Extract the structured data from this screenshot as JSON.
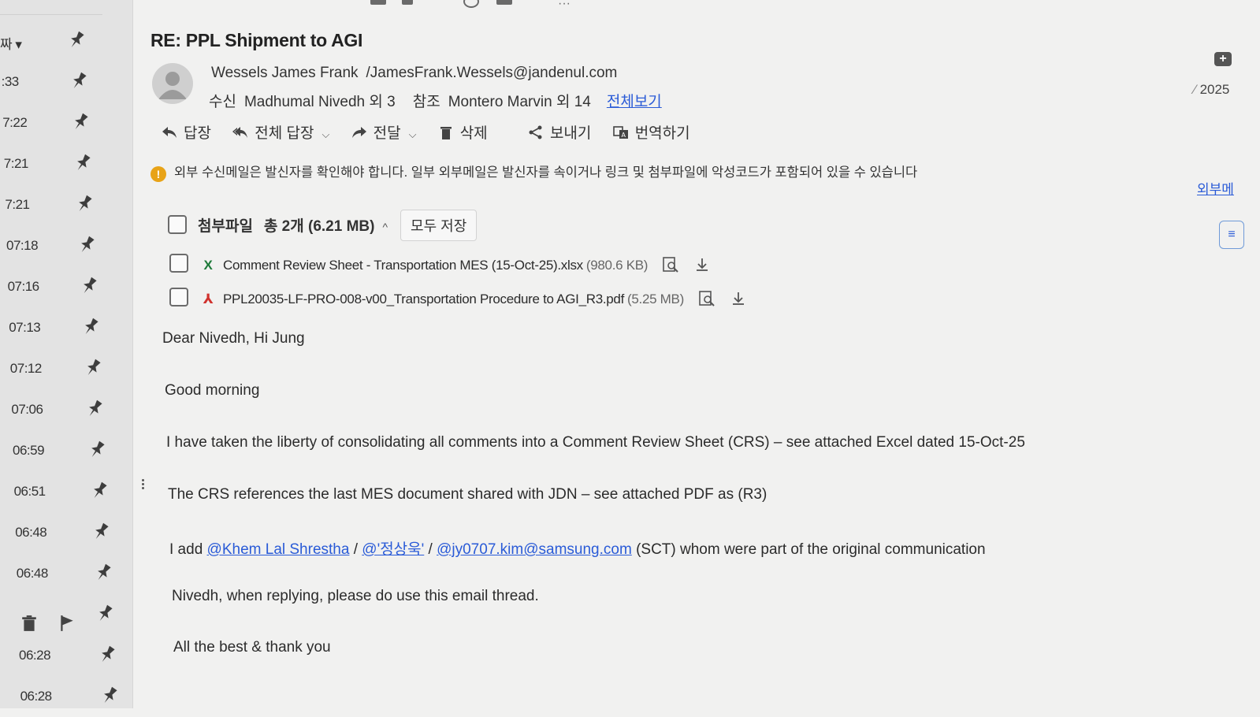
{
  "sidebar": {
    "items": [
      {
        "time": "짜 ▾"
      },
      {
        "time": ":33"
      },
      {
        "time": "7:22"
      },
      {
        "time": "7:21"
      },
      {
        "time": "7:21"
      },
      {
        "time": "07:18"
      },
      {
        "time": "07:16"
      },
      {
        "time": "07:13"
      },
      {
        "time": "07:12"
      },
      {
        "time": "07:06"
      },
      {
        "time": "06:59"
      },
      {
        "time": "06:51"
      },
      {
        "time": "06:48"
      },
      {
        "time": "06:48"
      },
      {
        "time": ""
      },
      {
        "time": "06:28"
      },
      {
        "time": "06:28"
      }
    ]
  },
  "email": {
    "subject": "RE: PPL Shipment to AGI",
    "from_name": "Wessels James Frank",
    "from_email": "/JamesFrank.Wessels@jandenul.com",
    "to_label": "수신",
    "to_value": "Madhumal Nivedh 외 3",
    "cc_label": "참조",
    "cc_value": "Montero Marvin 외 14",
    "view_all": "전체보기"
  },
  "actions": {
    "reply": "답장",
    "reply_all": "전체 답장",
    "forward": "전달",
    "delete": "삭제",
    "send": "보내기",
    "translate": "번역하기"
  },
  "warning": {
    "icon": "!",
    "text": "외부 수신메일은 발신자를 확인해야 합니다. 일부 외부메일은 발신자를 속이거나 링크 및 첨부파일에 악성코드가 포함되어 있을 수 있습니다"
  },
  "attachments": {
    "label": "첨부파일",
    "count": "총 2개 (6.21 MB)",
    "chevron": "^",
    "save_all": "모두 저장",
    "files": [
      {
        "icon": "excel-icon",
        "type_glyph": "X",
        "name": "Comment Review Sheet - Transportation MES (15-Oct-25).xlsx",
        "size": "(980.6 KB)"
      },
      {
        "icon": "pdf-icon",
        "type_glyph": "⅄",
        "name": "PPL20035-LF-PRO-008-v00_Transportation Procedure to AGI_R3.pdf",
        "size": "(5.25 MB)"
      }
    ]
  },
  "body": {
    "greeting": "Dear Nivedh, Hi Jung",
    "line1": "Good morning",
    "line2": "I have taken the liberty of consolidating all comments into a Comment Review Sheet (CRS) – see attached Excel dated 15-Oct-25",
    "line3": "The CRS references the last MES document shared with JDN – see attached PDF as (R3)",
    "line4_prefix": "I add",
    "mention1": "@Khem Lal Shrestha",
    "sep": "/",
    "mention2": "@'정상욱'",
    "mention3": "@jy0707.kim@samsung.com",
    "line4_suffix": "(SCT) whom were part of the original communication",
    "line5": "Nivedh, when replying, please do use this email thread.",
    "line6": "All the best & thank you"
  },
  "right": {
    "date": "2025",
    "external": "외부메",
    "plus": "+"
  },
  "colors": {
    "link": "#2a5bd7",
    "warning": "#e8a317",
    "excel": "#1e7a3a",
    "pdf": "#d0312d"
  }
}
